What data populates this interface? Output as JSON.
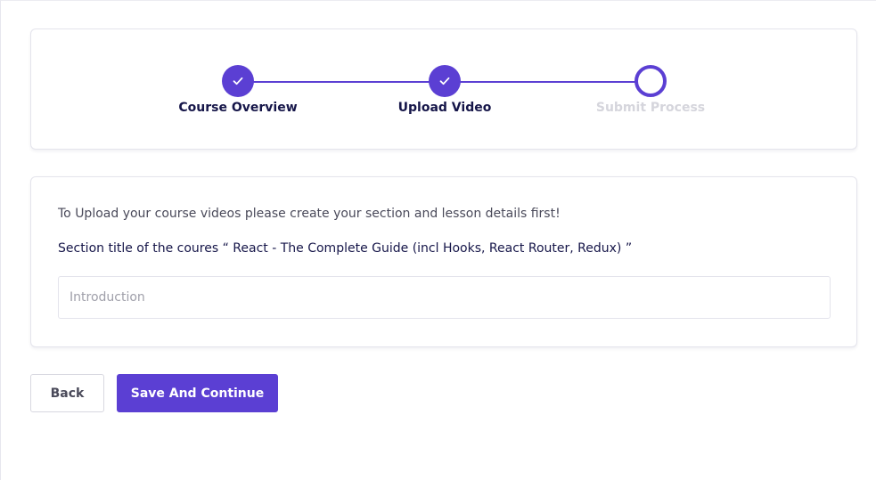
{
  "stepper": {
    "steps": [
      {
        "label": "Course Overview",
        "status": "complete"
      },
      {
        "label": "Upload Video",
        "status": "complete"
      },
      {
        "label": "Submit Process",
        "status": "pending"
      }
    ]
  },
  "form": {
    "instructions": "To Upload your course videos please create your section and lesson details first!",
    "section_title": "Section title of the coures “ React - The Complete Guide (incl Hooks, React Router, Redux) ”",
    "section_input": {
      "value": "",
      "placeholder": "Introduction"
    }
  },
  "actions": {
    "back_label": "Back",
    "save_label": "Save And Continue"
  },
  "colors": {
    "accent": "#5b3fd3",
    "heading": "#161649",
    "pending": "#d5d5dc"
  },
  "icons": {
    "step_complete": "check-icon"
  }
}
